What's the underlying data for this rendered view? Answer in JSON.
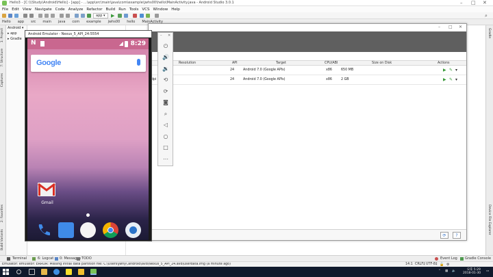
{
  "window": {
    "title": "Hello3 - [C:\\\\\\Study\\Android\\Hello] - [app] - ...\\app\\src\\main\\java\\com\\example\\jwhs00\\hello\\MainActivity.java - Android Studio 3.0.1"
  },
  "menu": [
    "File",
    "Edit",
    "View",
    "Navigate",
    "Code",
    "Analyze",
    "Refactor",
    "Build",
    "Run",
    "Tools",
    "VCS",
    "Window",
    "Help"
  ],
  "toolbar": {
    "run_config": "app ▾"
  },
  "breadcrumbs": [
    "Hello",
    "app",
    "src",
    "main",
    "java",
    "com",
    "example",
    "jwhs00",
    "hello",
    "MainActivity"
  ],
  "project_panel": {
    "items": [
      "Android ▾",
      "▸ app",
      "▸ Gradle"
    ]
  },
  "left_tabs": [
    "1: Project",
    "7: Structure",
    "Captures",
    "2: Favorites",
    "Build Variants"
  ],
  "right_tabs": [
    "Gradle",
    "Device File Explorer"
  ],
  "emulator": {
    "title": "Android Emulator - Nexus_5_API_24:5554",
    "clock": "8:29",
    "search_logo": "Google",
    "app_label": "Gmail"
  },
  "avd_manager": {
    "columns": [
      "Resolution",
      "API",
      "Target",
      "CPU/ABI",
      "Size on Disk",
      "Actions"
    ],
    "rows": [
      {
        "resolution": "",
        "api": "24",
        "target": "Android 7.0 (Google APIs)",
        "cpu": "x86",
        "size": "650 MB"
      },
      {
        "resolution": "dpi",
        "api": "24",
        "target": "Android 7.0 (Google APIs)",
        "cpu": "x86",
        "size": "2 GB"
      }
    ]
  },
  "bottom_tabs": [
    "Terminal",
    "6: Logcat",
    "0: Messages",
    "TODO",
    "Event Log",
    "Gradle Console"
  ],
  "status": {
    "message": "Emulator: emulator: ERROR: Missing initial data partition file: C:\\Users\\jwhy\\.android\\avd\\Nexus_5_API_24.avd\\userdata.img (a minute ago)",
    "position": "14:1",
    "line_sep": "CRLF‡",
    "encoding": "UTF-8‡"
  },
  "taskbar": {
    "time": "오후 5:29",
    "date": "2018-01-30"
  },
  "colors": {
    "accent": "#2b6cc4",
    "run_green": "#3a9a3a",
    "banner": "#5f5f5f",
    "taskbar": "#101a2c"
  }
}
